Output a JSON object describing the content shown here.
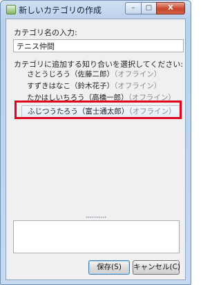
{
  "window": {
    "title": "新しいカテゴリの作成",
    "controls": {
      "minimize": "–",
      "maximize": "□",
      "close": "X"
    }
  },
  "form": {
    "name_label": "カテゴリ名の入力:",
    "name_value": "テニス仲間",
    "contacts_label": "カテゴリに追加する知り合いを選択してください:",
    "contacts": [
      {
        "name": "さとうじろう（佐藤二郎）",
        "status": "（オフライン）"
      },
      {
        "name": "すずきはなこ（鈴木花子）",
        "status": "（オフライン）"
      },
      {
        "name": "たかはしいちろう（高橋一郎）",
        "status": "（オフライン）"
      },
      {
        "name": "ふじつうたろう（富士通太郎）",
        "status": "（オフライン）"
      }
    ]
  },
  "buttons": {
    "save": "保存(S)",
    "cancel": "キャンセル(C)"
  },
  "colors": {
    "highlight": "#e0001b",
    "title_bar": "#b9d0ea"
  }
}
